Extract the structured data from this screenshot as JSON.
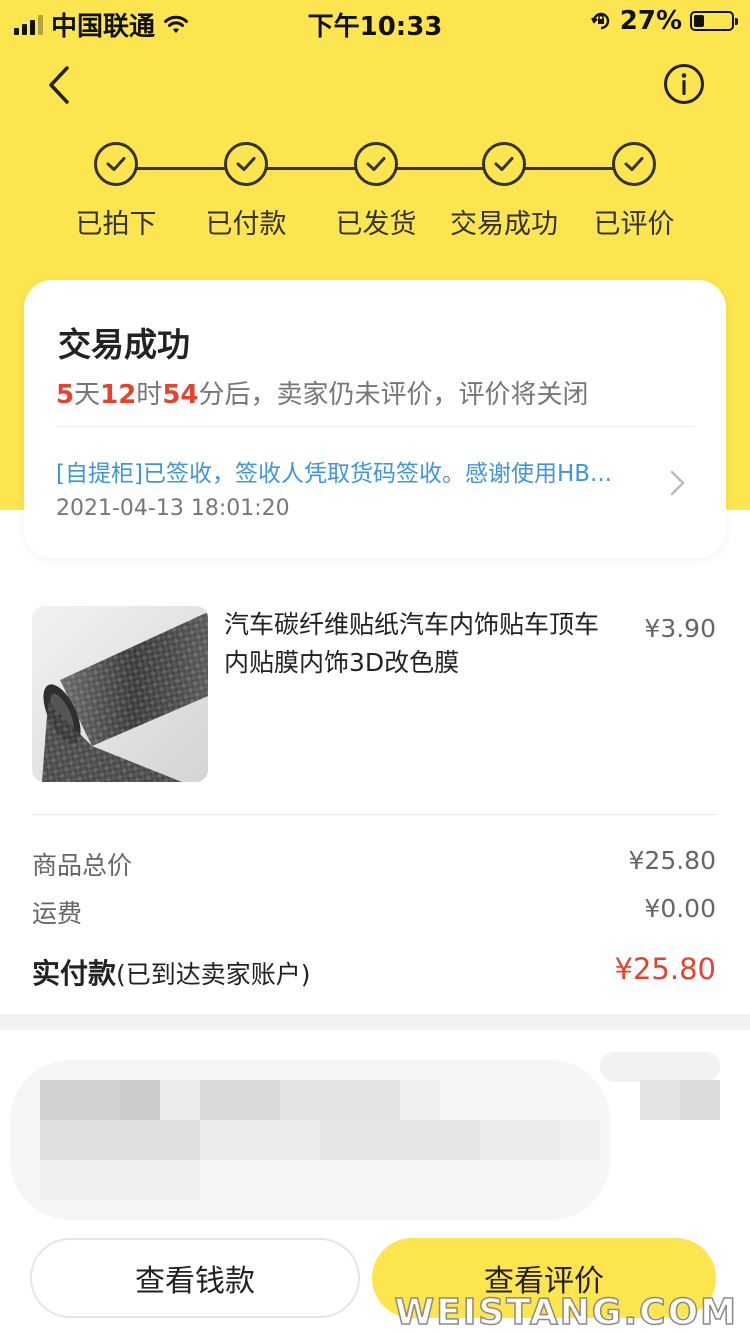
{
  "status_bar": {
    "carrier": "中国联通",
    "time": "下午10:33",
    "battery": "27%",
    "battery_level": 0.27
  },
  "header": {
    "back_icon": "chevron-left-icon",
    "info_icon": "info-circle-icon"
  },
  "steps": [
    {
      "label": "已拍下",
      "done": true
    },
    {
      "label": "已付款",
      "done": true
    },
    {
      "label": "已发货",
      "done": true
    },
    {
      "label": "交易成功",
      "done": true
    },
    {
      "label": "已评价",
      "done": true
    }
  ],
  "status_card": {
    "title": "交易成功",
    "countdown": {
      "days": "5",
      "days_unit": "天",
      "hours": "12",
      "hours_unit": "时",
      "minutes": "54",
      "minutes_unit": "分后，卖家仍未评价，评价将关闭"
    },
    "logistics_text": "[自提柜]已签收，签收人凭取货码签收。感谢使用HB...",
    "logistics_time": "2021-04-13 18:01:20"
  },
  "product": {
    "title": "汽车碳纤维贴纸汽车内饰贴车顶车内贴膜内饰3D改色膜",
    "price": "¥3.90"
  },
  "summary": {
    "goods_total_label": "商品总价",
    "goods_total_value": "¥25.80",
    "shipping_label": "运费",
    "shipping_value": "¥0.00",
    "paid_label": "实付款",
    "paid_note": "(已到达卖家账户)",
    "paid_value": "¥25.80"
  },
  "buttons": {
    "view_payment": "查看钱款",
    "view_review": "查看评价"
  },
  "watermark": "WEISTANG.COM",
  "colors": {
    "header_yellow": "#FDE54F",
    "accent_red": "#E8412E",
    "link_blue": "#3d95e5"
  }
}
